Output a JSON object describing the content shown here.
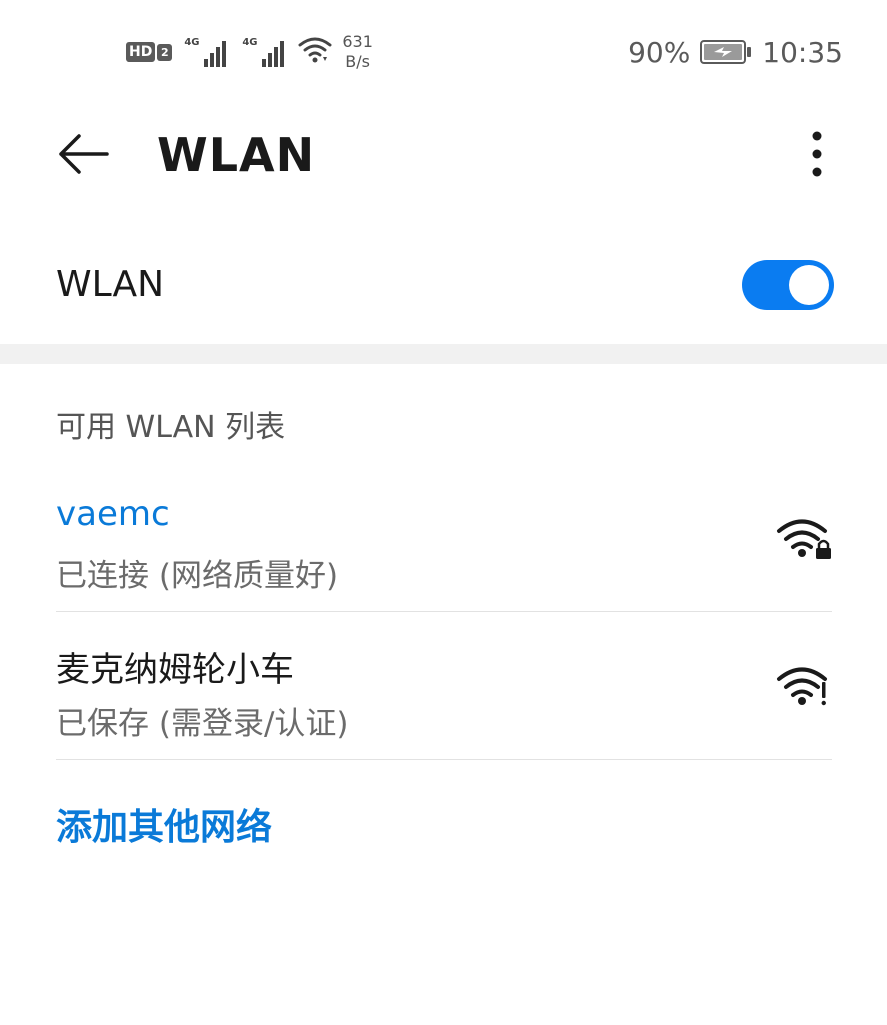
{
  "status_bar": {
    "hd_label": "HD",
    "hd_sim": "2",
    "sim1_network": "4G",
    "sim2_network": "4G",
    "speed_value": "631",
    "speed_unit": "B/s",
    "battery_percent": "90%",
    "time": "10:35",
    "icons": [
      "hd-icon",
      "signal-icon",
      "signal-icon",
      "wifi-icon",
      "battery-charging-icon"
    ]
  },
  "app_bar": {
    "title": "WLAN",
    "back_icon": "arrow-left-icon",
    "more_icon": "more-vert-icon"
  },
  "wlan_toggle": {
    "label": "WLAN",
    "enabled": true,
    "accent_color": "#0a7cf1"
  },
  "network_list": {
    "header": "可用 WLAN 列表",
    "networks": [
      {
        "name": "vaemc",
        "status": "已连接 (网络质量好)",
        "connected": true,
        "icon": "wifi-lock-icon"
      },
      {
        "name": "麦克纳姆轮小车",
        "status": "已保存 (需登录/认证)",
        "connected": false,
        "icon": "wifi-alert-icon"
      }
    ],
    "add_network_label": "添加其他网络",
    "link_color": "#0a7ad8"
  }
}
